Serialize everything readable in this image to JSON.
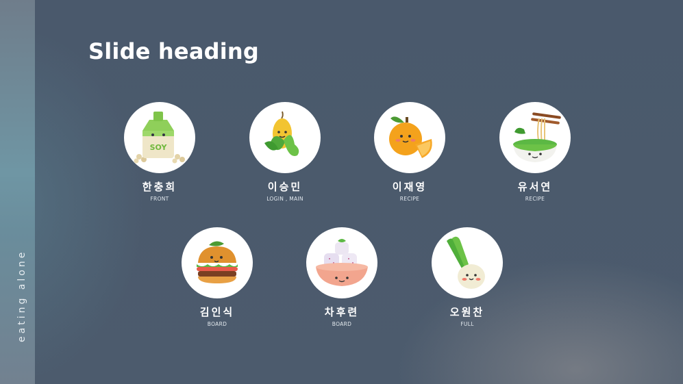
{
  "slide": {
    "heading": "Slide heading",
    "side_label": "eating alone"
  },
  "members": [
    {
      "name": "한충희",
      "role": "FRONT",
      "icon": "soy-milk-icon"
    },
    {
      "name": "이승민",
      "role": "LOGIN , MAIN",
      "icon": "corn-icon"
    },
    {
      "name": "이재영",
      "role": "RECIPE",
      "icon": "orange-icon"
    },
    {
      "name": "유서연",
      "role": "RECIPE",
      "icon": "noodle-bowl-icon"
    },
    {
      "name": "김인식",
      "role": "BOARD",
      "icon": "burger-icon"
    },
    {
      "name": "차후련",
      "role": "BOARD",
      "icon": "rice-cake-icon"
    },
    {
      "name": "오원찬",
      "role": "FULL",
      "icon": "green-onion-icon"
    }
  ]
}
